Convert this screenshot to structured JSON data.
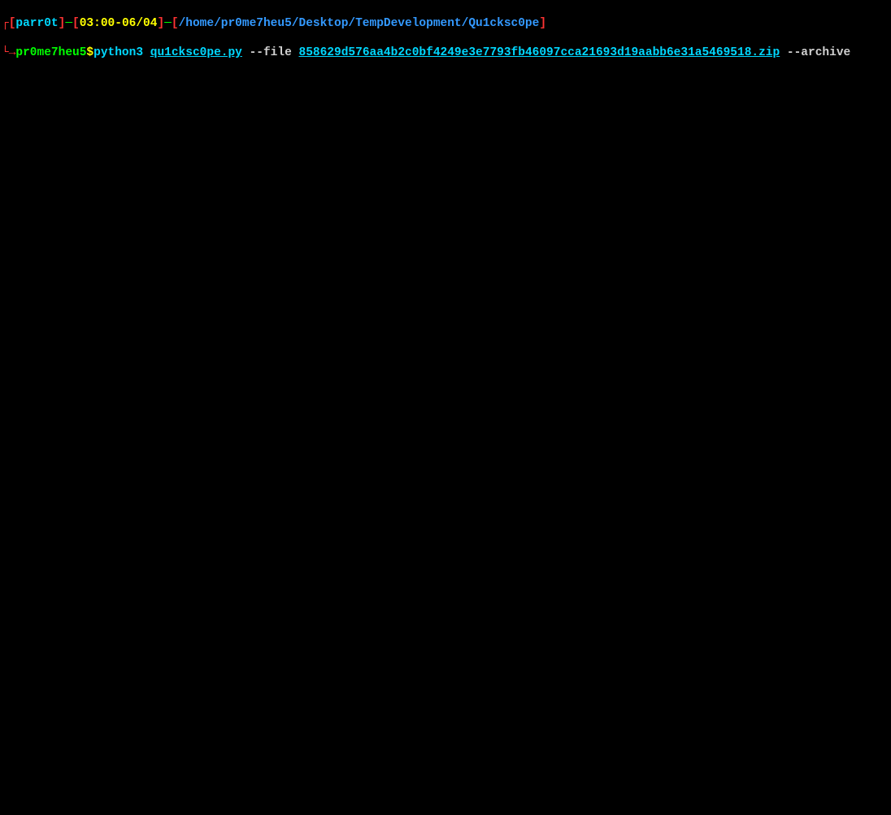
{
  "prompt_line1": {
    "corner_top": "┌",
    "bracket_open_1": "[",
    "hostname": "parr0t",
    "bracket_close_1": "]",
    "dash_1": "─",
    "bracket_open_2": "[",
    "timestamp": "03:00-06/04",
    "bracket_close_2": "]",
    "dash_2": "─",
    "bracket_open_3": "[",
    "cwd": "/home/pr0me7heu5/Desktop/TempDevelopment/Qu1cksc0pe",
    "bracket_close_3": "]"
  },
  "prompt_line2": {
    "corner_bottom": "└→",
    "username": "pr0me7heu5",
    "dollar": "$",
    "cmd_python": "python3 ",
    "cmd_script": "qu1cksc0pe.py",
    "cmd_flag_file": " --file ",
    "cmd_filename": "858629d576aa4b2c0bf4249e3e7793fb46097cca21693d19aabb6e31a5469518.zip",
    "cmd_flag_archive": " --archive"
  }
}
